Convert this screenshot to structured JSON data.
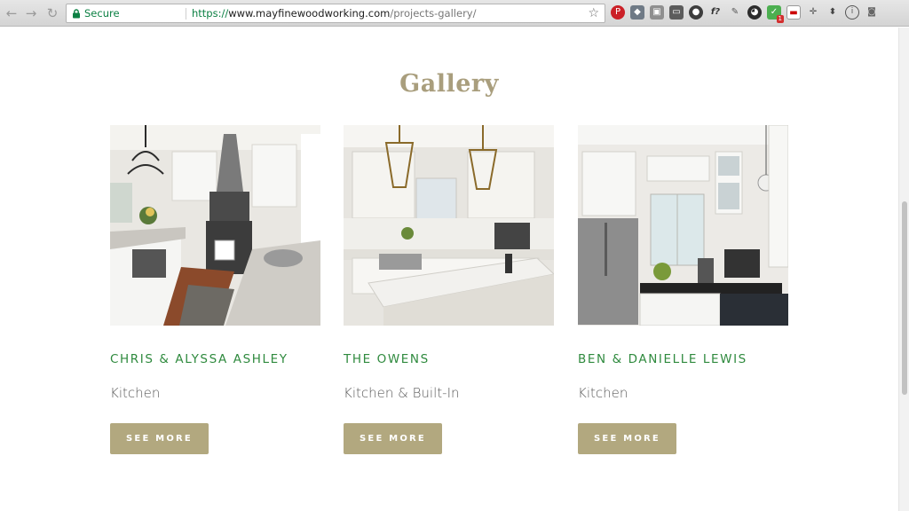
{
  "browser": {
    "secure_label": "Secure",
    "url_scheme": "https://",
    "url_host": "www.mayfinewoodworking.com",
    "url_path": "/projects-gallery/",
    "extensions": [
      {
        "name": "pinterest-icon",
        "glyph": "P"
      },
      {
        "name": "dropbox-icon",
        "glyph": "◆"
      },
      {
        "name": "extension-icon",
        "glyph": "▣"
      },
      {
        "name": "screen-capture-icon",
        "glyph": "▭"
      },
      {
        "name": "color-wheel-icon",
        "glyph": "●"
      },
      {
        "name": "font-finder-icon",
        "glyph": "f?"
      },
      {
        "name": "eyedropper-icon",
        "glyph": "✎"
      },
      {
        "name": "panda-icon",
        "glyph": "◕"
      },
      {
        "name": "checker-icon",
        "glyph": "✓",
        "badge": "1"
      },
      {
        "name": "calendar-icon",
        "glyph": "▬"
      },
      {
        "name": "crosshair-icon",
        "glyph": "✛"
      },
      {
        "name": "jump-icon",
        "glyph": "⬍"
      },
      {
        "name": "info-icon",
        "glyph": "i"
      },
      {
        "name": "camera-icon",
        "glyph": "◙"
      }
    ]
  },
  "page": {
    "title": "Gallery",
    "projects": [
      {
        "name": "CHRIS & ALYSSA ASHLEY",
        "type": "Kitchen",
        "button": "SEE MORE"
      },
      {
        "name": "THE OWENS",
        "type": "Kitchen & Built-In",
        "button": "SEE MORE"
      },
      {
        "name": "BEN & DANIELLE LEWIS",
        "type": "Kitchen",
        "button": "SEE MORE"
      }
    ]
  },
  "colors": {
    "title": "#a99e7d",
    "project_name": "#2f8a3e",
    "button_bg": "#b2a87f",
    "secure_green": "#0b8043"
  }
}
